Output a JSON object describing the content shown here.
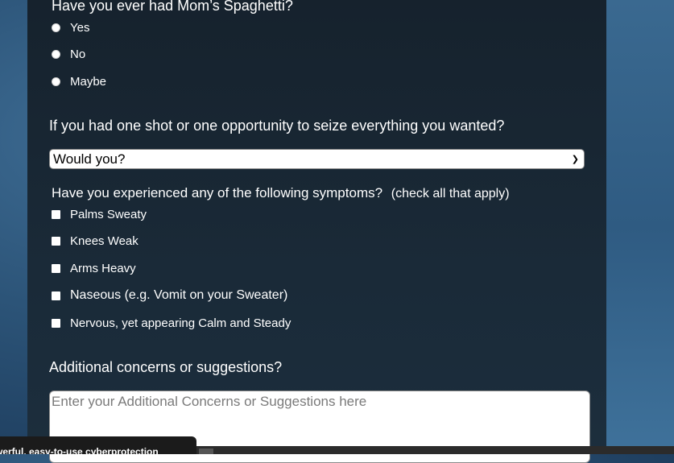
{
  "q1": {
    "title": "Have you ever had Mom’s Spaghetti?",
    "options": [
      "Yes",
      "No",
      "Maybe"
    ]
  },
  "q2": {
    "title": "If you had one shot or one opportunity to seize everything you wanted?",
    "selected": "Would you?"
  },
  "q3": {
    "title": "Have you experienced any of the following symptoms?",
    "hint": "(check all that apply)",
    "options": [
      "Palms Sweaty",
      "Knees Weak",
      "Arms Heavy",
      "Naseous (e.g. Vomit on your Sweater)",
      "Nervous, yet appearing Calm and Steady"
    ]
  },
  "q4": {
    "title": "Additional concerns or suggestions?",
    "placeholder": "Enter your Additional Concerns or Suggestions here"
  },
  "status": {
    "tooltip": "werful, easy-to-use cyberprotection"
  }
}
